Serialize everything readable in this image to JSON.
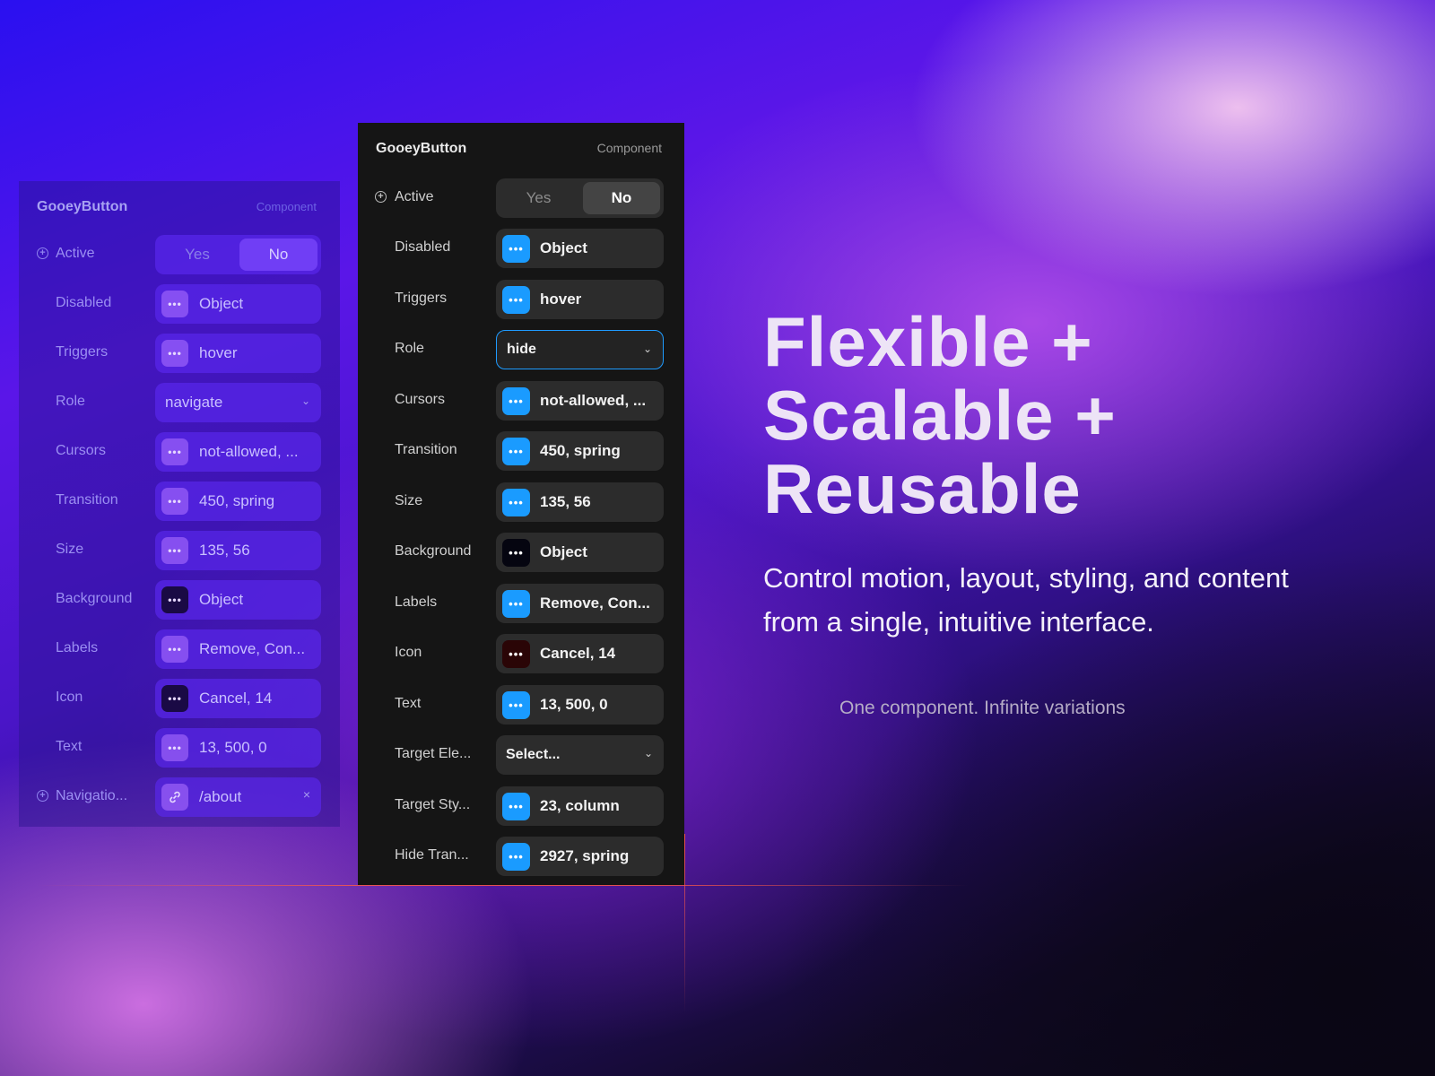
{
  "ghost_panel": {
    "title": "GooeyButton",
    "type": "Component",
    "active": {
      "label": "Active",
      "yes": "Yes",
      "no": "No"
    },
    "rows": [
      {
        "label": "Disabled",
        "value": "Object"
      },
      {
        "label": "Triggers",
        "value": "hover"
      },
      {
        "label": "Role",
        "value": "navigate"
      },
      {
        "label": "Cursors",
        "value": "not-allowed, ..."
      },
      {
        "label": "Transition",
        "value": "450, spring"
      },
      {
        "label": "Size",
        "value": "135, 56"
      },
      {
        "label": "Background",
        "value": "Object"
      },
      {
        "label": "Labels",
        "value": "Remove, Con..."
      },
      {
        "label": "Icon",
        "value": "Cancel, 14"
      },
      {
        "label": "Text",
        "value": "13, 500, 0"
      },
      {
        "label": "Navigatio...",
        "value": "/about",
        "clear": "×"
      }
    ]
  },
  "main_panel": {
    "title": "GooeyButton",
    "type": "Component",
    "active": {
      "label": "Active",
      "yes": "Yes",
      "no": "No"
    },
    "rows": [
      {
        "label": "Disabled",
        "value": "Object"
      },
      {
        "label": "Triggers",
        "value": "hover"
      },
      {
        "label": "Role",
        "value": "hide"
      },
      {
        "label": "Cursors",
        "value": "not-allowed, ..."
      },
      {
        "label": "Transition",
        "value": "450, spring"
      },
      {
        "label": "Size",
        "value": "135, 56"
      },
      {
        "label": "Background",
        "value": "Object"
      },
      {
        "label": "Labels",
        "value": "Remove, Con..."
      },
      {
        "label": "Icon",
        "value": "Cancel, 14"
      },
      {
        "label": "Text",
        "value": "13, 500, 0"
      },
      {
        "label": "Target Ele...",
        "value": "Select..."
      },
      {
        "label": "Target Sty...",
        "value": "23, column"
      },
      {
        "label": "Hide Tran...",
        "value": "2927, spring"
      }
    ]
  },
  "badge_glyph": "•••",
  "chevron_glyph": "⌄",
  "hero": {
    "line1": "Flexible +",
    "line2": "Scalable +",
    "line3": "Reusable",
    "subtitle": "Control motion, layout, styling, and content from a single, intuitive interface.",
    "tagline": "One component. Infinite variations"
  },
  "colors": {
    "accent": "#1a9bff",
    "panel": "#151515",
    "field": "#2c2c2c"
  }
}
